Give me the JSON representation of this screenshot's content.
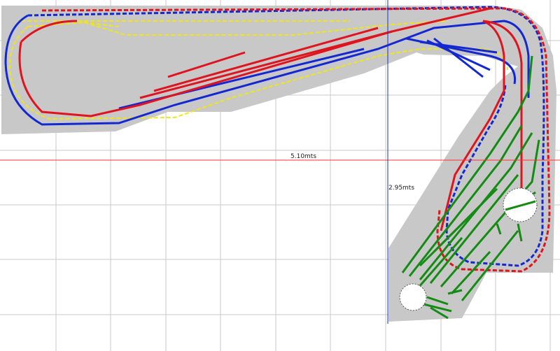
{
  "title": "",
  "dimensions": {
    "width_label": "5.10mts",
    "height_label": "2.95mts"
  },
  "colors": {
    "background": "#ffffff",
    "grid": "#c8c8c8",
    "baseboard": "#c8c8c8",
    "red_track": "#e0141e",
    "blue_track": "#1428d2",
    "yellow_track": "#f0e614",
    "green_track": "#148c14",
    "width_measure_line": "#ff3030",
    "height_measure_line": "#2030c0"
  },
  "legend": []
}
